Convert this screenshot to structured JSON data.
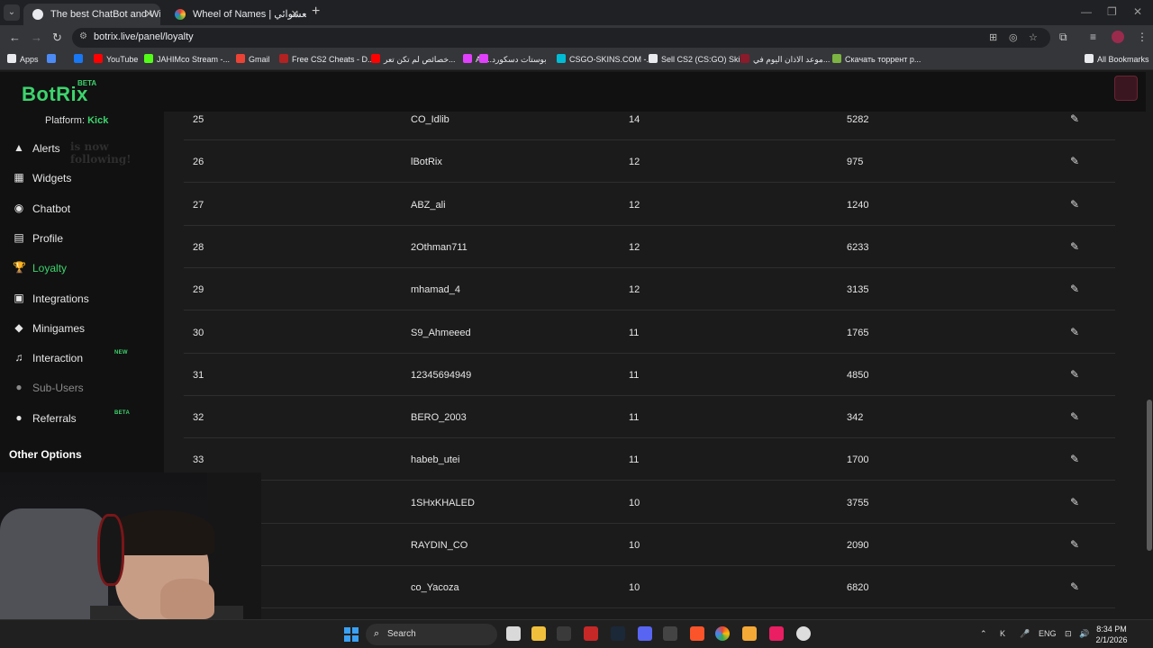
{
  "browser": {
    "tabs": [
      {
        "title": "The best ChatBot and Widgets f",
        "active": true
      },
      {
        "title": "Wheel of Names | سم العشوائي",
        "active": false
      }
    ],
    "url": "botrix.live/panel/loyalty",
    "bookmarks": [
      {
        "label": "Apps",
        "color": "#e8eaed"
      },
      {
        "label": "",
        "color": "#4c8bf5"
      },
      {
        "label": "",
        "color": "#1877f2"
      },
      {
        "label": "YouTube",
        "color": "#ff0000"
      },
      {
        "label": "JAHIMco Stream -...",
        "color": "#53fc18"
      },
      {
        "label": "Gmail",
        "color": "#ea4335"
      },
      {
        "label": "Free CS2 Cheats - D...",
        "color": "#b22222"
      },
      {
        "label": "خصائص لم تكن تعر...",
        "color": "#ff0000"
      },
      {
        "label": "As...",
        "color": "#e040fb"
      },
      {
        "label": "بوستات دسكورد",
        "color": "#e040fb"
      },
      {
        "label": "CSGO-SKINS.COM -...",
        "color": "#00bcd4"
      },
      {
        "label": "Sell CS2 (CS:GO) Ski...",
        "color": "#e8eaed"
      },
      {
        "label": "موعد الاذان اليوم في...",
        "color": "#8b1a2b"
      },
      {
        "label": "Скачать торрент р...",
        "color": "#7cb342"
      },
      {
        "label": "All Bookmarks",
        "color": "#e8eaed"
      }
    ]
  },
  "app": {
    "logo": "BotRix",
    "logo_badge": "BETA",
    "platform_label": "Platform:",
    "platform_value": "Kick",
    "ghost_text": "is now following!",
    "nav": [
      {
        "label": "Alerts",
        "icon": "warning-icon",
        "glyph": "▲"
      },
      {
        "label": "Widgets",
        "icon": "widgets-icon",
        "glyph": "▦"
      },
      {
        "label": "Chatbot",
        "icon": "robot-icon",
        "glyph": "◉"
      },
      {
        "label": "Profile",
        "icon": "id-card-icon",
        "glyph": "▤"
      },
      {
        "label": "Loyalty",
        "icon": "trophy-icon",
        "glyph": "🏆"
      },
      {
        "label": "Integrations",
        "icon": "integration-icon",
        "glyph": "▣"
      },
      {
        "label": "Minigames",
        "icon": "gamepad-icon",
        "glyph": "◆"
      },
      {
        "label": "Interaction",
        "icon": "music-icon",
        "glyph": "♫"
      },
      {
        "label": "Sub-Users",
        "icon": "users-icon",
        "glyph": "●"
      },
      {
        "label": "Referrals",
        "icon": "referrals-icon",
        "glyph": "●"
      }
    ],
    "interaction_tag": "NEW",
    "referrals_tag": "BETA",
    "other_options": "Other Options"
  },
  "table": {
    "rows": [
      {
        "rank": "25",
        "user": "CO_Idlib",
        "hours": "14",
        "points": "5282"
      },
      {
        "rank": "26",
        "user": "lBotRix",
        "hours": "12",
        "points": "975"
      },
      {
        "rank": "27",
        "user": "ABZ_ali",
        "hours": "12",
        "points": "1240"
      },
      {
        "rank": "28",
        "user": "2Othman711",
        "hours": "12",
        "points": "6233"
      },
      {
        "rank": "29",
        "user": "mhamad_4",
        "hours": "12",
        "points": "3135"
      },
      {
        "rank": "30",
        "user": "S9_Ahmeeed",
        "hours": "11",
        "points": "1765"
      },
      {
        "rank": "31",
        "user": "12345694949",
        "hours": "11",
        "points": "4850"
      },
      {
        "rank": "32",
        "user": "BERO_2003",
        "hours": "11",
        "points": "342"
      },
      {
        "rank": "33",
        "user": "habeb_utei",
        "hours": "11",
        "points": "1700"
      },
      {
        "rank": "",
        "user": "1SHxKHALED",
        "hours": "10",
        "points": "3755"
      },
      {
        "rank": "",
        "user": "RAYDIN_CO",
        "hours": "10",
        "points": "2090"
      },
      {
        "rank": "",
        "user": "co_Yacoza",
        "hours": "10",
        "points": "6820"
      }
    ]
  },
  "taskbar": {
    "search_placeholder": "Search",
    "lang": "ENG",
    "time": "8:34 PM",
    "date": "2/1/2026"
  },
  "colors": {
    "accent": "#3dd46d",
    "background": "#1b1b1b",
    "sidebar": "#111111"
  }
}
